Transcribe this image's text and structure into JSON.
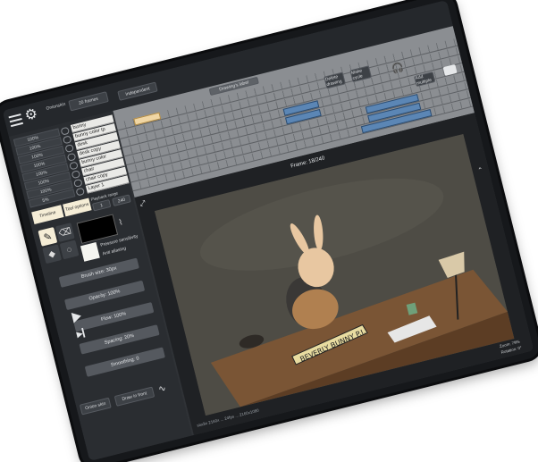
{
  "toolbar": {
    "menu_icon": "hamburger-icon",
    "settings_icon": "gear-icon",
    "onion_label": "Onionskin",
    "onion_frames": "20 frames",
    "mode_value": "Independent",
    "drawing_label": "Drawing's label"
  },
  "layers": {
    "opacities": [
      "100%",
      "100%",
      "100%",
      "100%",
      "100%",
      "100%",
      "100%",
      "100%",
      "100%",
      "5%"
    ],
    "names": [
      "bunny",
      "bunny color tp",
      "desk",
      "desk copy",
      "bunny color",
      "chair",
      "chair copy",
      "Layer 1"
    ],
    "modify_layers": "Modify layers",
    "add_drawing": "Add drawing",
    "timeline_label": "Timeline",
    "tool_options_label": "Tool options",
    "playback_range_label": "Playback range",
    "range_start": "1",
    "range_end": "240"
  },
  "timeline_buttons": {
    "delete_drawing": "Delete drawing",
    "make_cycle": "Make cycle",
    "add_multiple": "Add multiple"
  },
  "tools": {
    "pressure_sensitivity": "Pressure sensitivity",
    "antialiasing": "Anti aliasing",
    "brush_size": "Brush size: 30px",
    "opacity": "Opacity: 100%",
    "flow": "Flow: 100%",
    "spacing": "Spacing: 20%",
    "smoothing": "Smoothing: 0",
    "colors": {
      "current": "#000000",
      "accent": "#f5edd6"
    }
  },
  "bottom": {
    "onion_skin": "Onion skin",
    "draw_in_front": "Draw in front",
    "dimensions": "studio 2160x ... 24fps ... 2160x1080"
  },
  "canvas": {
    "frame_label": "Frame: 18/240",
    "nameplate": "BEVERLY BUNNY P.I.",
    "zoom": "Zoom: 79%",
    "rotation": "Rotation: 0°"
  }
}
